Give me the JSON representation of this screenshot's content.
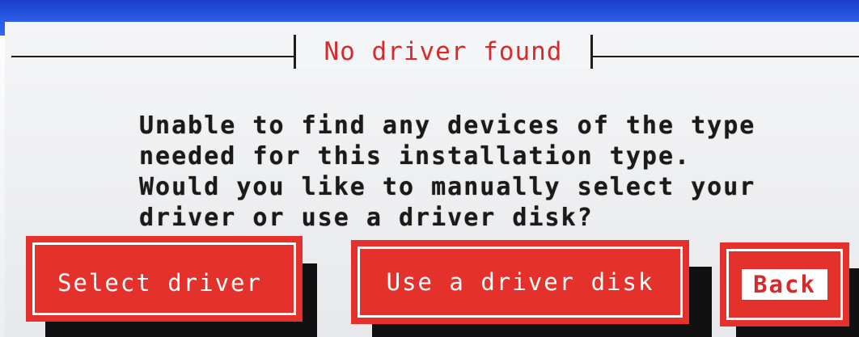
{
  "dialog": {
    "title": "No driver found",
    "message_lines": [
      "Unable to find any devices of the type",
      "needed for this installation type.",
      "Would you like to manually select your",
      "driver or use a driver disk?"
    ]
  },
  "buttons": {
    "select_driver": "Select driver",
    "use_driver_disk": "Use a driver disk",
    "back": "Back"
  },
  "colors": {
    "button_red": "#e5312b",
    "title_red": "#d82a2a",
    "desktop_blue": "#2a5ae6"
  }
}
